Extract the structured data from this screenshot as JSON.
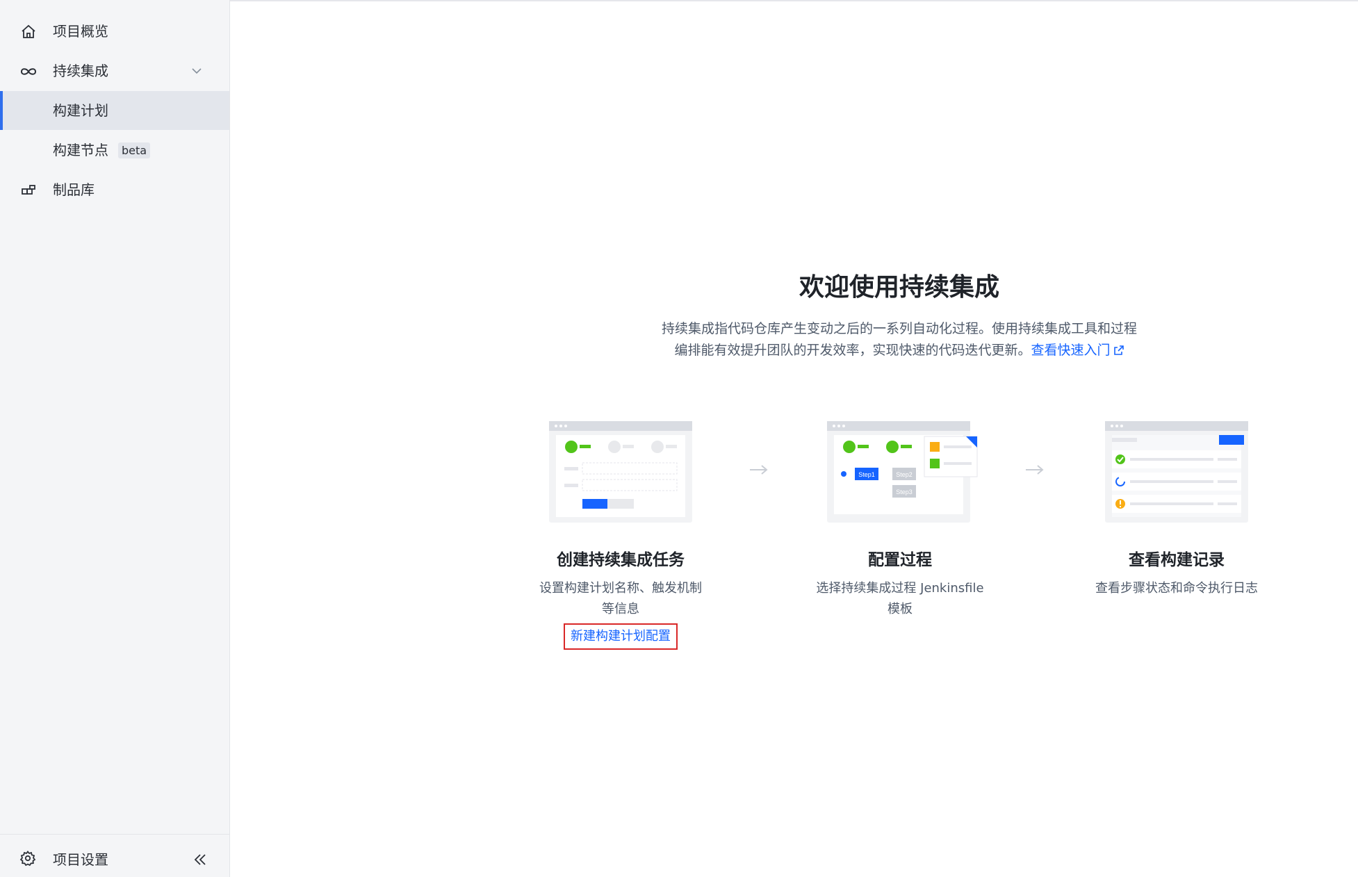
{
  "sidebar": {
    "items": [
      {
        "label": "项目概览",
        "icon": "home-icon"
      },
      {
        "label": "持续集成",
        "icon": "infinity-icon",
        "expanded": true
      },
      {
        "label": "构建计划",
        "active": true
      },
      {
        "label": "构建节点",
        "badge": "beta"
      },
      {
        "label": "制品库",
        "icon": "artifact-icon"
      }
    ],
    "footer": {
      "label": "项目设置",
      "icon": "gear-icon"
    }
  },
  "main": {
    "title": "欢迎使用持续集成",
    "description_line1": "持续集成指代码仓库产生变动之后的一系列自动化过程。使用持续集成工具和过程",
    "description_line2": "编排能有效提升团队的开发效率，实现快速的代码迭代更新。",
    "quickstart_link": "查看快速入门",
    "steps": [
      {
        "title": "创建持续集成任务",
        "desc": "设置构建计划名称、触发机制等信息",
        "link": "新建构建计划配置"
      },
      {
        "title": "配置过程",
        "desc": "选择持续集成过程 Jenkinsfile 模板"
      },
      {
        "title": "查看构建记录",
        "desc": "查看步骤状态和命令执行日志"
      }
    ],
    "illustration_labels": [
      "Step1",
      "Step2",
      "Step3"
    ]
  },
  "colors": {
    "accent": "#1664ff",
    "sidebar_bg": "#f4f5f7",
    "active_indicator": "#2f6fed",
    "highlight_box": "#d92727",
    "success": "#52c41a",
    "warning": "#faad14"
  }
}
